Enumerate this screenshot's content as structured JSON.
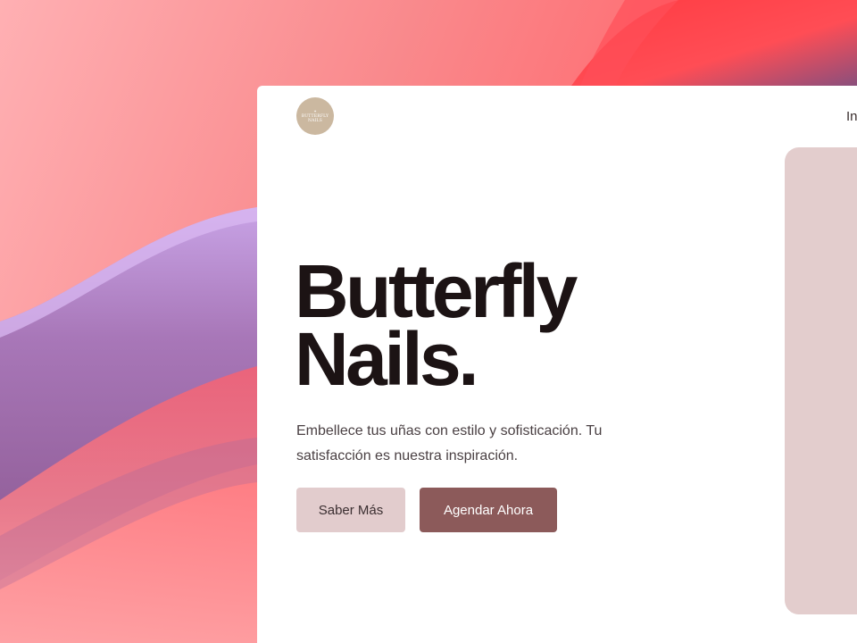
{
  "wallpaper": {
    "colors": {
      "base": "#f48a8c",
      "pink_light": "#ffb3b5",
      "coral": "#ff5a5f",
      "red": "#ff3b3f",
      "purple": "#a56fb0",
      "violet_light": "#c9a6e0",
      "plum": "#7a4f7a"
    }
  },
  "site": {
    "logo": {
      "icon": "butterfly-icon",
      "line1": "BUTTERFLY",
      "line2": "NAILS",
      "color": "#cbb8a0"
    },
    "nav": {
      "first_link": "In"
    },
    "hero": {
      "title_line1": "Butterfly",
      "title_line2": "Nails.",
      "subtitle": "Embellece tus uñas con estilo y sofisticación. Tu satisfacción es nuestra inspiración.",
      "secondary_button": "Saber Más",
      "primary_button": "Agendar Ahora"
    },
    "colors": {
      "title": "#1c1314",
      "body_text": "#4a4043",
      "secondary_button_bg": "#e2cccd",
      "primary_button_bg": "#8c5a5a",
      "image_card_bg": "#e3cdcd"
    }
  }
}
